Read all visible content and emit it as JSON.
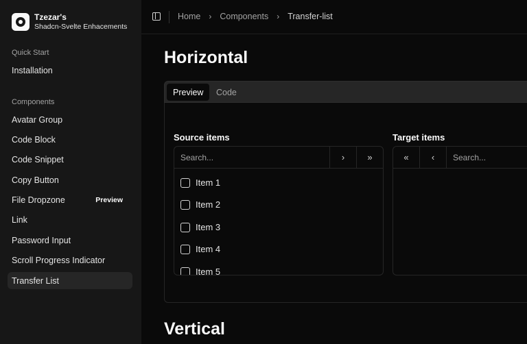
{
  "brand": {
    "name": "Tzezar's",
    "subtitle": "Shadcn-Svelte Enhacements"
  },
  "sidebar": {
    "groups": [
      {
        "label": "Quick Start",
        "items": [
          {
            "label": "Installation"
          }
        ]
      },
      {
        "label": "Components",
        "items": [
          {
            "label": "Avatar Group"
          },
          {
            "label": "Code Block"
          },
          {
            "label": "Code Snippet"
          },
          {
            "label": "Copy Button"
          },
          {
            "label": "File Dropzone",
            "badge": "Preview"
          },
          {
            "label": "Link"
          },
          {
            "label": "Password Input"
          },
          {
            "label": "Scroll Progress Indicator"
          },
          {
            "label": "Transfer List",
            "active": true
          }
        ]
      }
    ]
  },
  "breadcrumb": {
    "items": [
      "Home",
      "Components",
      "Transfer-list"
    ],
    "separator": "›"
  },
  "main": {
    "section1_title": "Horizontal",
    "section2_title": "Vertical",
    "tabs": [
      {
        "label": "Preview",
        "active": true
      },
      {
        "label": "Code"
      }
    ],
    "source": {
      "title": "Source items",
      "search_placeholder": "Search...",
      "move_one": "›",
      "move_all": "»",
      "items": [
        "Item 1",
        "Item 2",
        "Item 3",
        "Item 4",
        "Item 5"
      ]
    },
    "target": {
      "title": "Target items",
      "search_placeholder": "Search...",
      "move_all_back": "«",
      "move_one_back": "‹",
      "items": []
    }
  },
  "colors": {
    "background": "#0a0a0a",
    "sidebar": "#171717",
    "active_item": "#262626",
    "border": "#262626"
  }
}
